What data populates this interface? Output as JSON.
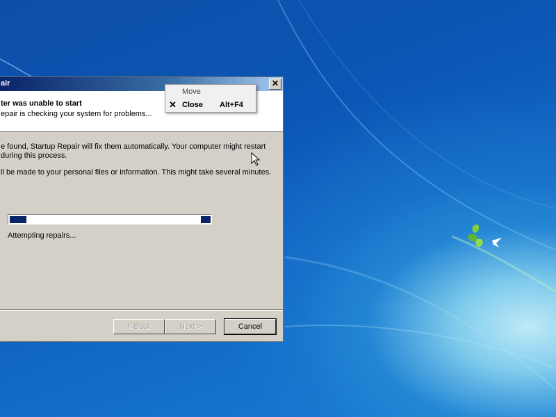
{
  "dialog": {
    "title": "air",
    "close_glyph": "✕",
    "header_title": "ter was unable to start",
    "header_subtitle": "epair is checking your system for problems...",
    "body_line1": "e found, Startup Repair will fix them automatically. Your computer might restart",
    "body_line2": " during this process.",
    "body_line3": "ll be made to your personal files or information. This might take several minutes.",
    "status": "Attempting repairs...",
    "buttons": {
      "back": "< Back",
      "next": "Next >",
      "cancel": "Cancel"
    }
  },
  "context_menu": {
    "items": [
      {
        "label": "Move",
        "accelerator": "",
        "icon": ""
      },
      {
        "label": "Close",
        "accelerator": "Alt+F4",
        "icon": "close-icon"
      }
    ],
    "close_glyph": "✕"
  },
  "colors": {
    "titlebar_start": "#0a246a",
    "titlebar_end": "#a6caf0",
    "dialog_bg": "#d4d0c8",
    "progress_chunk": "#0a246a",
    "desktop_blue": "#0b56b4"
  }
}
